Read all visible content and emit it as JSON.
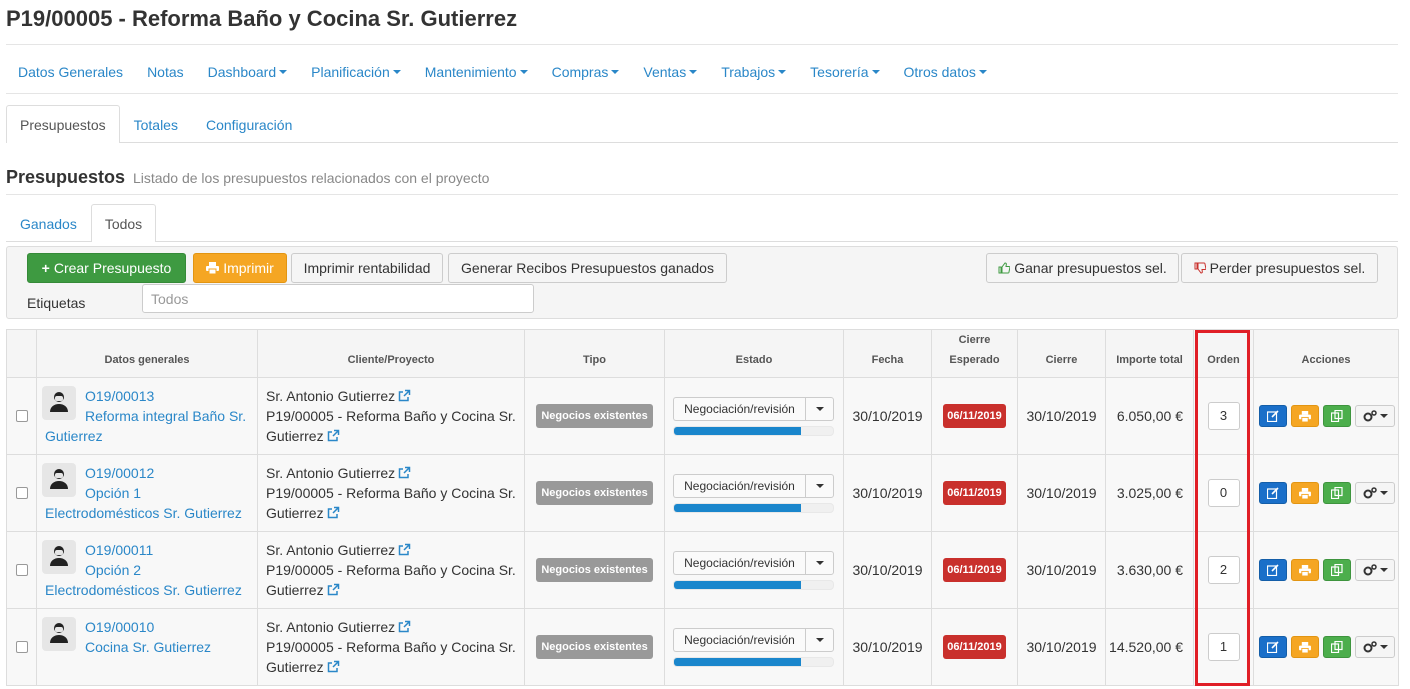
{
  "page_title": "P19/00005 - Reforma Baño y Cocina Sr. Gutierrez",
  "main_nav": [
    {
      "label": "Datos Generales",
      "dropdown": false
    },
    {
      "label": "Notas",
      "dropdown": false
    },
    {
      "label": "Dashboard",
      "dropdown": true
    },
    {
      "label": "Planificación",
      "dropdown": true
    },
    {
      "label": "Mantenimiento",
      "dropdown": true
    },
    {
      "label": "Compras",
      "dropdown": true
    },
    {
      "label": "Ventas",
      "dropdown": true
    },
    {
      "label": "Trabajos",
      "dropdown": true
    },
    {
      "label": "Tesorería",
      "dropdown": true
    },
    {
      "label": "Otros datos",
      "dropdown": true
    }
  ],
  "sub_tabs": [
    "Presupuestos",
    "Totales",
    "Configuración"
  ],
  "section": {
    "title": "Presupuestos",
    "subtitle": "Listado de los presupuestos relacionados con el proyecto"
  },
  "filter_tabs": [
    "Ganados",
    "Todos"
  ],
  "toolbar": {
    "crear": "Crear Presupuesto",
    "imprimir": "Imprimir",
    "rentabilidad": "Imprimir rentabilidad",
    "recibos": "Generar Recibos Presupuestos ganados",
    "ganar": "Ganar presupuestos sel.",
    "perder": "Perder presupuestos sel.",
    "etiquetas_label": "Etiquetas",
    "etiquetas_placeholder": "Todos"
  },
  "columns": {
    "datos": "Datos generales",
    "cliente": "Cliente/Proyecto",
    "tipo": "Tipo",
    "estado": "Estado",
    "fecha": "Fecha",
    "cierre_esperado_1": "Cierre",
    "cierre_esperado_2": "Esperado",
    "cierre": "Cierre",
    "importe": "Importe total",
    "orden": "Orden",
    "acciones": "Acciones"
  },
  "rows": [
    {
      "code": "O19/00013",
      "name_l1": "Reforma integral Baño Sr.",
      "name_l2": "Gutierrez",
      "cliente": "Sr. Antonio Gutierrez",
      "proyecto_l1": "P19/00005 - Reforma Baño y Cocina Sr.",
      "proyecto_l2": "Gutierrez",
      "tipo": "Negocios existentes",
      "estado": "Negociación/revisión",
      "progress": 0.8,
      "fecha": "30/10/2019",
      "cierre_esperado": "06/11/2019",
      "cierre": "30/10/2019",
      "importe": "6.050,00 €",
      "orden": "3"
    },
    {
      "code": "O19/00012",
      "name_l1": "Opción 1",
      "name_l2": "Electrodomésticos Sr. Gutierrez",
      "cliente": "Sr. Antonio Gutierrez",
      "proyecto_l1": "P19/00005 - Reforma Baño y Cocina Sr.",
      "proyecto_l2": "Gutierrez",
      "tipo": "Negocios existentes",
      "estado": "Negociación/revisión",
      "progress": 0.8,
      "fecha": "30/10/2019",
      "cierre_esperado": "06/11/2019",
      "cierre": "30/10/2019",
      "importe": "3.025,00 €",
      "orden": "0"
    },
    {
      "code": "O19/00011",
      "name_l1": "Opción 2",
      "name_l2": "Electrodomésticos Sr. Gutierrez",
      "cliente": "Sr. Antonio Gutierrez",
      "proyecto_l1": "P19/00005 - Reforma Baño y Cocina Sr.",
      "proyecto_l2": "Gutierrez",
      "tipo": "Negocios existentes",
      "estado": "Negociación/revisión",
      "progress": 0.8,
      "fecha": "30/10/2019",
      "cierre_esperado": "06/11/2019",
      "cierre": "30/10/2019",
      "importe": "3.630,00 €",
      "orden": "2"
    },
    {
      "code": "O19/00010",
      "name_l1": "Cocina Sr. Gutierrez",
      "name_l2": "",
      "cliente": "Sr. Antonio Gutierrez",
      "proyecto_l1": "P19/00005 - Reforma Baño y Cocina Sr.",
      "proyecto_l2": "Gutierrez",
      "tipo": "Negocios existentes",
      "estado": "Negociación/revisión",
      "progress": 0.8,
      "fecha": "30/10/2019",
      "cierre_esperado": "06/11/2019",
      "cierre": "30/10/2019",
      "importe": "14.520,00 €",
      "orden": "1"
    }
  ],
  "colors": {
    "link": "#2a87c8",
    "success": "#3e9a41",
    "warning": "#f5a623",
    "primary": "#1a6fc9",
    "danger": "#c9302c",
    "highlight": "#e01e26"
  }
}
